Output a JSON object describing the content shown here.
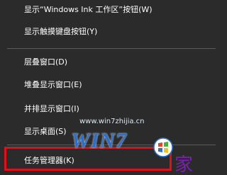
{
  "menu": {
    "items": [
      {
        "label": "显示“Windows Ink 工作区”按钮(W)"
      },
      {
        "label": "显示触摸键盘按钮(Y)"
      },
      {
        "label": "层叠窗口(D)"
      },
      {
        "label": "堆叠显示窗口(E)"
      },
      {
        "label": "并排显示窗口(I)"
      },
      {
        "label": "显示桌面(S)"
      },
      {
        "label": "任务管理器(K)"
      }
    ]
  },
  "watermark": {
    "url": "www.win7zhijia.cn",
    "logo_text": "WIN7",
    "logo_char": "家"
  },
  "colors": {
    "menu_background": "#2b2b2b",
    "text": "#ffffff",
    "separator": "#5a5a5a",
    "highlight_border": "#e0101a",
    "watermark_blue": "#2f6fc8"
  }
}
